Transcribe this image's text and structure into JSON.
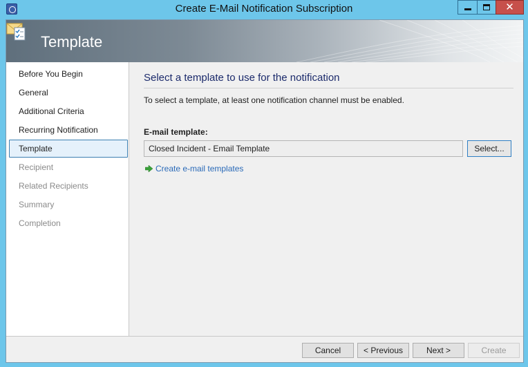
{
  "window": {
    "title": "Create E-Mail Notification Subscription",
    "close_glyph": "✕"
  },
  "banner": {
    "title": "Template",
    "icon": "envelope-checklist-icon"
  },
  "nav": {
    "items": [
      {
        "label": "Before You Begin",
        "state": "enabled"
      },
      {
        "label": "General",
        "state": "enabled"
      },
      {
        "label": "Additional Criteria",
        "state": "enabled"
      },
      {
        "label": "Recurring Notification",
        "state": "enabled"
      },
      {
        "label": "Template",
        "state": "selected"
      },
      {
        "label": "Recipient",
        "state": "disabled"
      },
      {
        "label": "Related Recipients",
        "state": "disabled"
      },
      {
        "label": "Summary",
        "state": "disabled"
      },
      {
        "label": "Completion",
        "state": "disabled"
      }
    ]
  },
  "main": {
    "heading": "Select a template to use for the notification",
    "info": "To select a template, at least one notification channel must be enabled.",
    "field_label": "E-mail template:",
    "field_value": "Closed Incident - Email Template",
    "select_label": "Select...",
    "link_label": "Create e-mail templates"
  },
  "footer": {
    "cancel": "Cancel",
    "previous": "< Previous",
    "next": "Next >",
    "create": "Create"
  },
  "colors": {
    "frame": "#6dc6ea",
    "close_button": "#c7504b",
    "heading": "#1b2a6b",
    "link": "#2a6ab8",
    "selection_border": "#3c7fb1"
  }
}
